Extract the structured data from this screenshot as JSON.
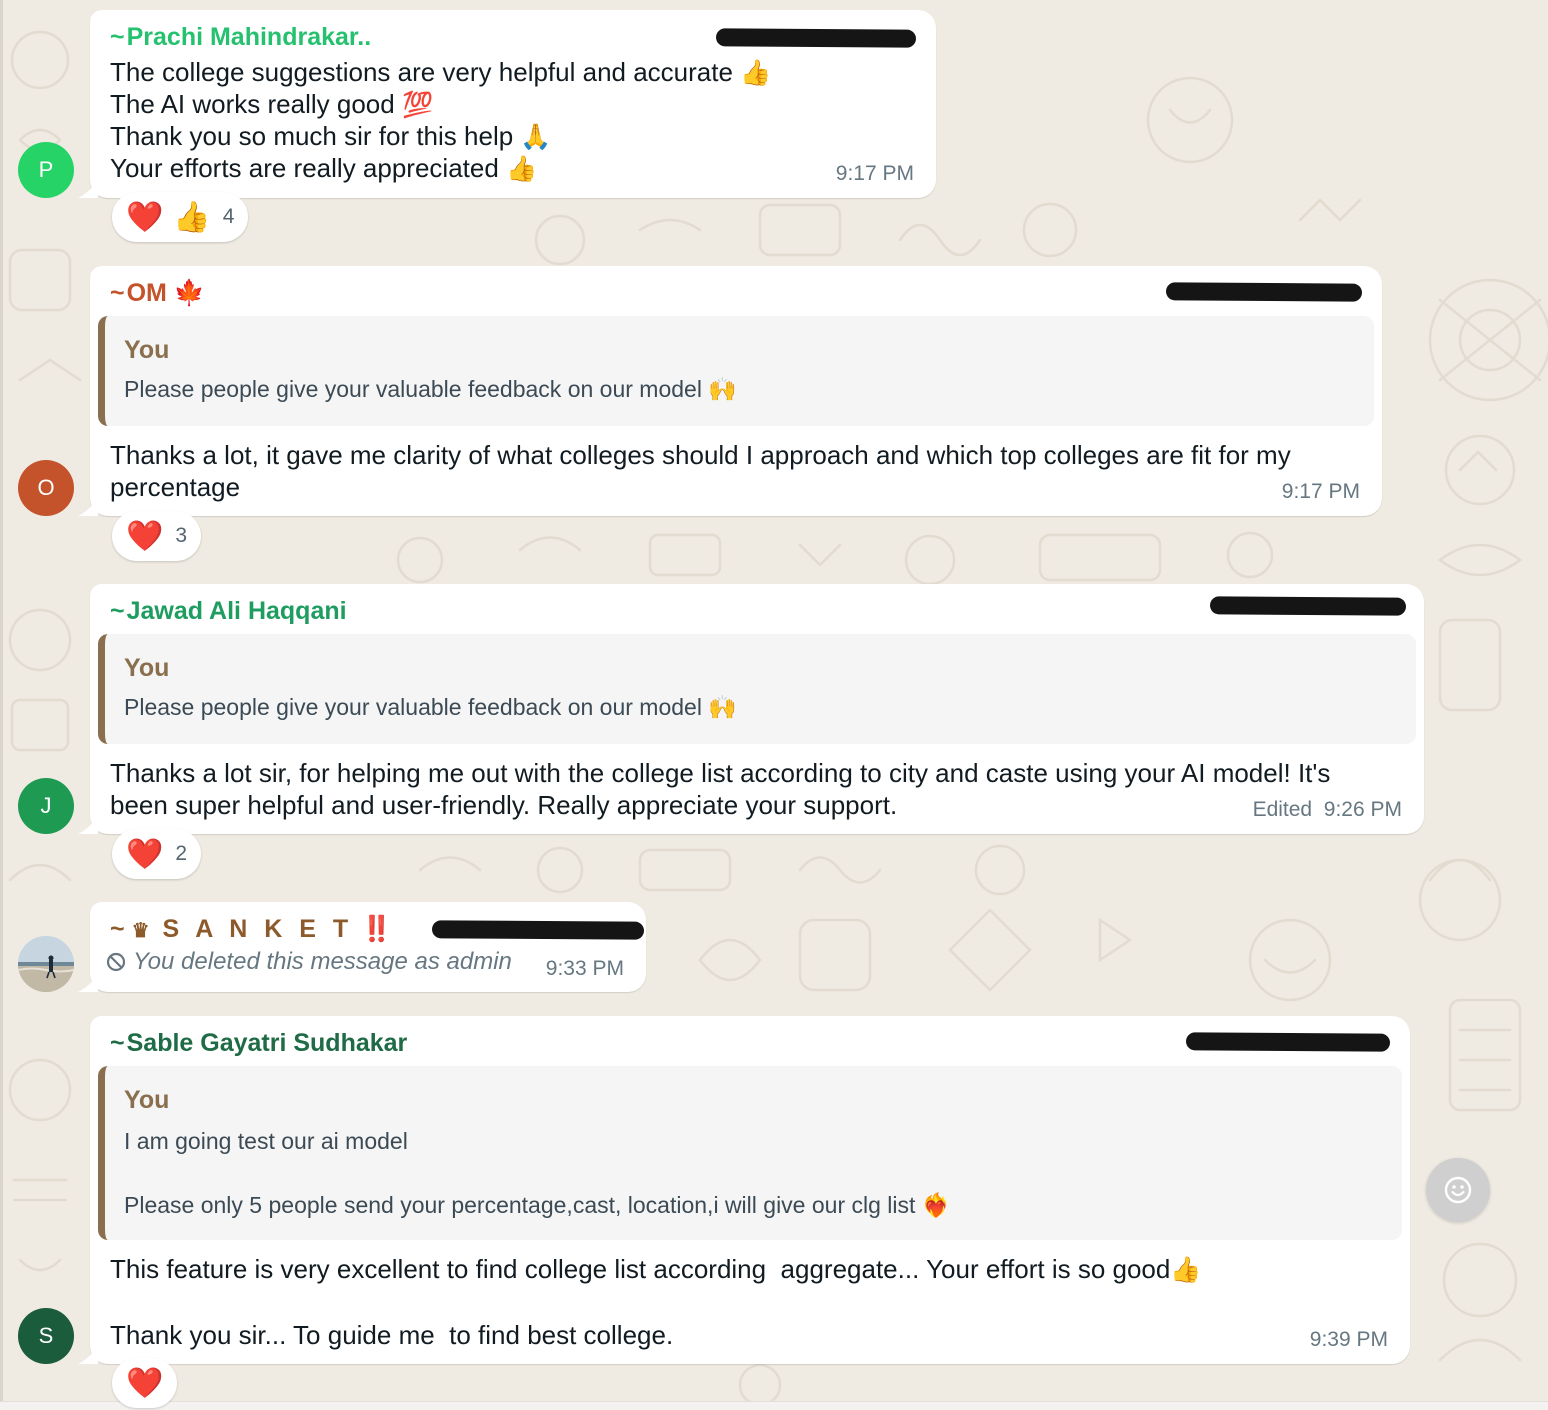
{
  "theme": {
    "chat_background": "#efeae2",
    "bubble_background": "#ffffff",
    "quote_background": "#f5f5f5",
    "quote_bar_color": "#8a6f4e",
    "time_color": "#667781"
  },
  "messages": [
    {
      "sender_prefix": "~",
      "sender": "Prachi Mahindrakar..",
      "sender_color": "#25c16f",
      "avatar_initial": "P",
      "avatar_color": "#25d366",
      "lines": [
        "The college suggestions are very helpful and accurate",
        "The AI works really good",
        "Thank you so much sir for this help",
        "Your efforts are really appreciated"
      ],
      "line_emojis": [
        "👍",
        "💯",
        "🙏",
        "👍"
      ],
      "time": "9:17 PM",
      "reactions": [
        "❤️",
        "👍"
      ],
      "reaction_count": "4"
    },
    {
      "sender_prefix": "~",
      "sender": "OM",
      "sender_emoji": "🍁",
      "sender_color": "#c4522b",
      "avatar_initial": "O",
      "avatar_color": "#c4522b",
      "quote": {
        "author": "You",
        "text": "Please people give your valuable feedback on our model",
        "emoji": "🙌"
      },
      "lines": [
        "Thanks a lot, it gave me clarity of what colleges should I approach and which top colleges are fit for my",
        "percentage"
      ],
      "time": "9:17 PM",
      "reactions": [
        "❤️"
      ],
      "reaction_count": "3"
    },
    {
      "sender_prefix": "~",
      "sender": "Jawad Ali Haqqani",
      "sender_color": "#1f9d61",
      "avatar_initial": "J",
      "avatar_color": "#1e9a52",
      "quote": {
        "author": "You",
        "text": "Please people give your valuable feedback on our model",
        "emoji": "🙌"
      },
      "lines": [
        "Thanks a lot sir, for helping me out with the college list according to city and caste using your AI model! It's",
        "been super helpful and user-friendly. Really appreciate your support."
      ],
      "edited_label": "Edited",
      "time": "9:26 PM",
      "reactions": [
        "❤️"
      ],
      "reaction_count": "2"
    },
    {
      "sender_prefix": "~",
      "sender": "S A N K E T",
      "sender_crown": "♛",
      "sender_emoji": "‼️",
      "sender_color": "#8c5a2b",
      "deleted_text": "You deleted this message as admin",
      "deleted_icon": "blocked-icon",
      "time": "9:33 PM"
    },
    {
      "sender_prefix": "~",
      "sender": "Sable Gayatri Sudhakar",
      "sender_color": "#1e6b45",
      "avatar_initial": "S",
      "avatar_color": "#1a5c3b",
      "quote": {
        "author": "You",
        "text_line1": "I am going test our ai model",
        "text_line2": "Please only 5 people send your percentage,cast, location,i will give our clg list",
        "emoji": "❤️‍🔥"
      },
      "lines": [
        "This feature is very excellent to find college list according  aggregate... Your effort is so good",
        "Thank you sir... To guide me  to find best college."
      ],
      "line_emojis": [
        "👍"
      ],
      "time": "9:39 PM",
      "reactions": [
        "❤️"
      ]
    }
  ],
  "emoji_button_icon": "smiley-icon"
}
